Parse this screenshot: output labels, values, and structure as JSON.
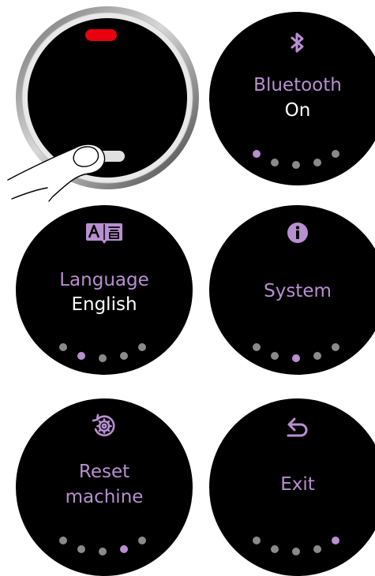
{
  "colors": {
    "accent": "#b88fd0",
    "screen": "#000000",
    "text": "#ffffff",
    "dot_inactive": "#8a8a8a",
    "indicator": "#e8000f"
  },
  "screens": [
    {
      "id": "bluetooth",
      "icon": "bluetooth-icon",
      "title": "Bluetooth",
      "value": "On",
      "active_dot": 0
    },
    {
      "id": "language",
      "icon": "language-icon",
      "title": "Language",
      "value": "English",
      "active_dot": 1
    },
    {
      "id": "system",
      "icon": "info-icon",
      "title": "System",
      "value": "",
      "active_dot": 2
    },
    {
      "id": "reset",
      "icon": "reset-gear-icon",
      "title": "Reset",
      "value": "machine",
      "active_dot": 3
    },
    {
      "id": "exit",
      "icon": "back-arrow-icon",
      "title": "Exit",
      "value": "",
      "active_dot": 4
    }
  ],
  "dot_count": 5
}
